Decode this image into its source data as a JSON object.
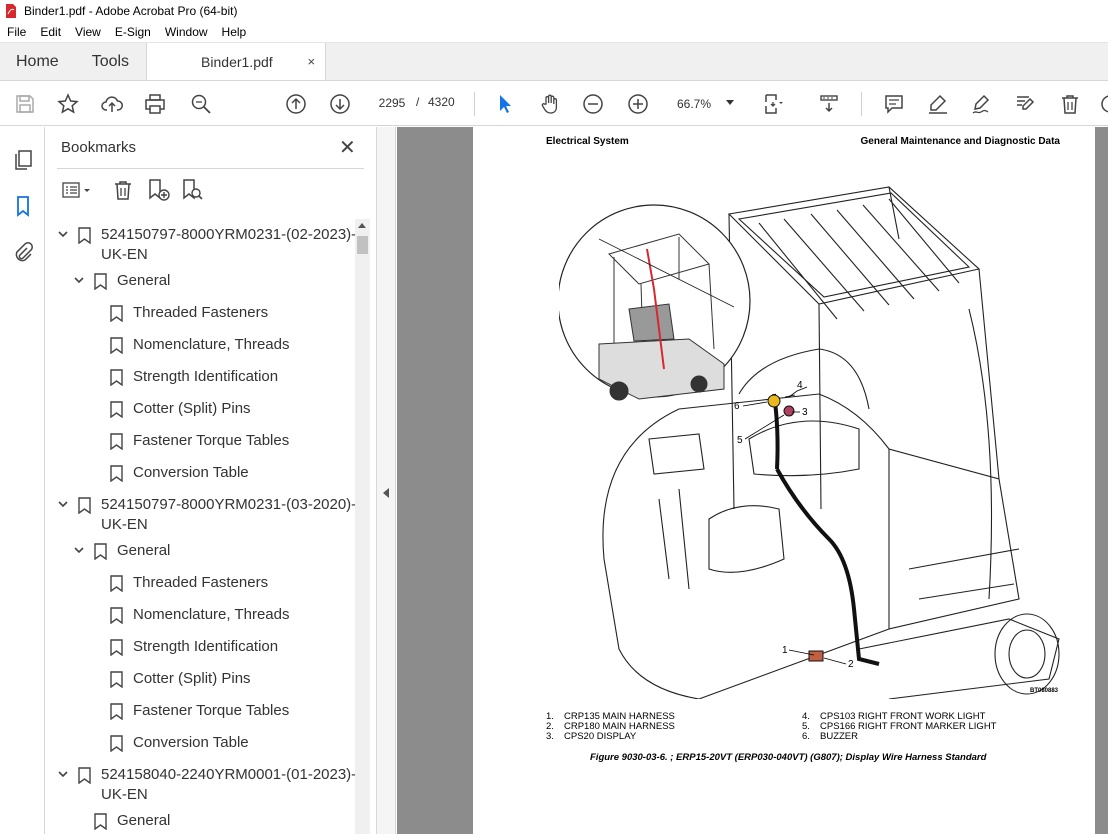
{
  "window": {
    "title": "Binder1.pdf - Adobe Acrobat Pro (64-bit)"
  },
  "menu": [
    "File",
    "Edit",
    "View",
    "E-Sign",
    "Window",
    "Help"
  ],
  "tabs": {
    "home": "Home",
    "tools": "Tools",
    "document": "Binder1.pdf",
    "close": "×"
  },
  "toolbar": {
    "current_page": "2295",
    "separator": "/",
    "total_pages": "4320",
    "zoom": "66.7%"
  },
  "panel": {
    "title": "Bookmarks",
    "close": "✕",
    "items": [
      {
        "label": "524150797-8000YRM0231-(02-2023)-",
        "label2": "UK-EN",
        "level": 0
      },
      {
        "label": "General",
        "level": 1
      },
      {
        "label": "Threaded Fasteners",
        "level": 2
      },
      {
        "label": "Nomenclature, Threads",
        "level": 2
      },
      {
        "label": "Strength Identification",
        "level": 2
      },
      {
        "label": "Cotter (Split) Pins",
        "level": 2
      },
      {
        "label": "Fastener Torque Tables",
        "level": 2
      },
      {
        "label": "Conversion Table",
        "level": 2
      },
      {
        "label": "524150797-8000YRM0231-(03-2020)-",
        "label2": "UK-EN",
        "level": 0
      },
      {
        "label": "General",
        "level": 1
      },
      {
        "label": "Threaded Fasteners",
        "level": 2
      },
      {
        "label": "Nomenclature, Threads",
        "level": 2
      },
      {
        "label": "Strength Identification",
        "level": 2
      },
      {
        "label": "Cotter (Split) Pins",
        "level": 2
      },
      {
        "label": "Fastener Torque Tables",
        "level": 2
      },
      {
        "label": "Conversion Table",
        "level": 2
      },
      {
        "label": "524158040-2240YRM0001-(01-2023)-",
        "label2": "UK-EN",
        "level": 0
      },
      {
        "label": "General",
        "level": 1
      }
    ]
  },
  "document": {
    "header_left": "Electrical System",
    "header_right": "General Maintenance and Diagnostic Data",
    "callouts": [
      "1",
      "2",
      "3",
      "4",
      "5",
      "6"
    ],
    "figure_code": "BT080883",
    "legend": [
      {
        "num": "1.",
        "text": "CRP135 MAIN HARNESS"
      },
      {
        "num": "2.",
        "text": "CRP180 MAIN HARNESS"
      },
      {
        "num": "3.",
        "text": "CPS20 DISPLAY"
      },
      {
        "num": "4.",
        "text": "CPS103 RIGHT FRONT WORK LIGHT"
      },
      {
        "num": "5.",
        "text": "CPS166 RIGHT FRONT MARKER LIGHT"
      },
      {
        "num": "6.",
        "text": "BUZZER"
      }
    ],
    "caption": "Figure 9030-03-6. ; ERP15-20VT (ERP030-040VT) (G807);  Display Wire Harness Standard"
  },
  "colors": {
    "accent_blue": "#1473e6",
    "acrobat_red": "#d7282f",
    "doc_bg": "#8c8c8c"
  }
}
